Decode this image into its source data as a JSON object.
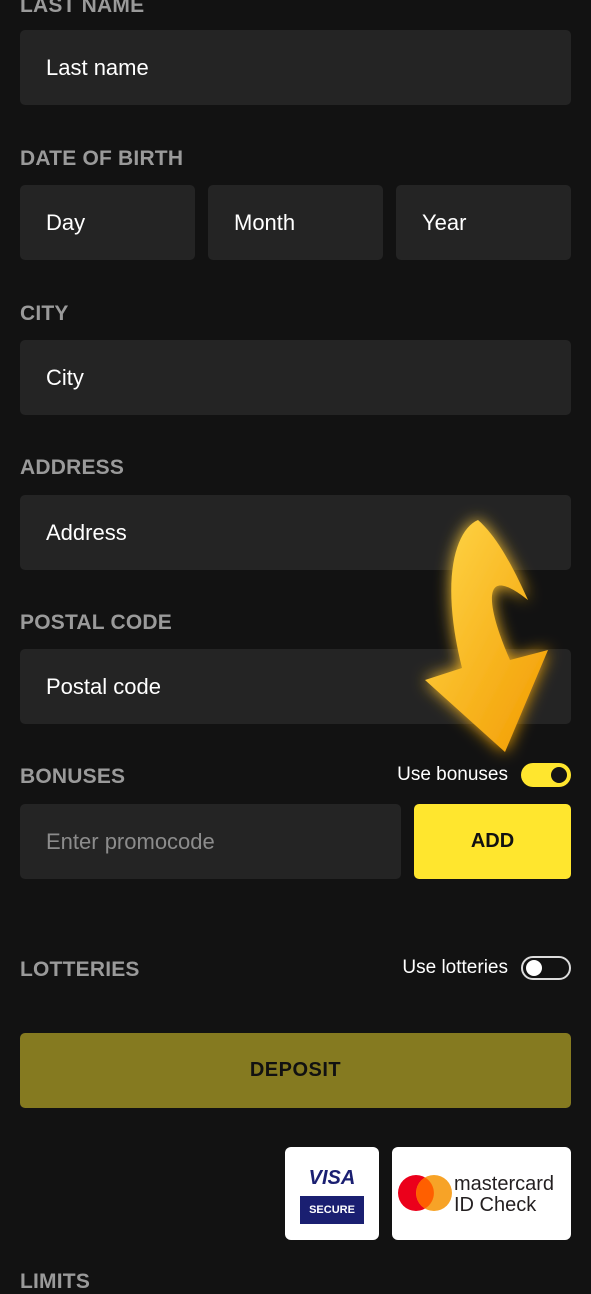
{
  "labels": {
    "last_name": "LAST NAME",
    "date_of_birth": "DATE OF BIRTH",
    "city": "CITY",
    "address": "ADDRESS",
    "postal_code": "POSTAL CODE",
    "bonuses": "BONUSES",
    "lotteries": "LOTTERIES",
    "bottom_cut": "LIMITS"
  },
  "fields": {
    "last_name": "Last name",
    "day": "Day",
    "month": "Month",
    "year": "Year",
    "city": "City",
    "address": "Address",
    "postal_code": "Postal code",
    "promocode_placeholder": "Enter promocode"
  },
  "toggles": {
    "use_bonuses": {
      "label": "Use bonuses",
      "on": true
    },
    "use_lotteries": {
      "label": "Use lotteries",
      "on": false
    }
  },
  "buttons": {
    "add": "ADD",
    "deposit": "DEPOSIT"
  },
  "badges": {
    "visa_line1": "VISA",
    "visa_line2": "SECURE",
    "mc_line1": "mastercard",
    "mc_line2": "ID Check"
  },
  "colors": {
    "accent": "#ffe62e",
    "deposit": "#857a20",
    "field_bg": "#242424",
    "page_bg": "#121212"
  }
}
